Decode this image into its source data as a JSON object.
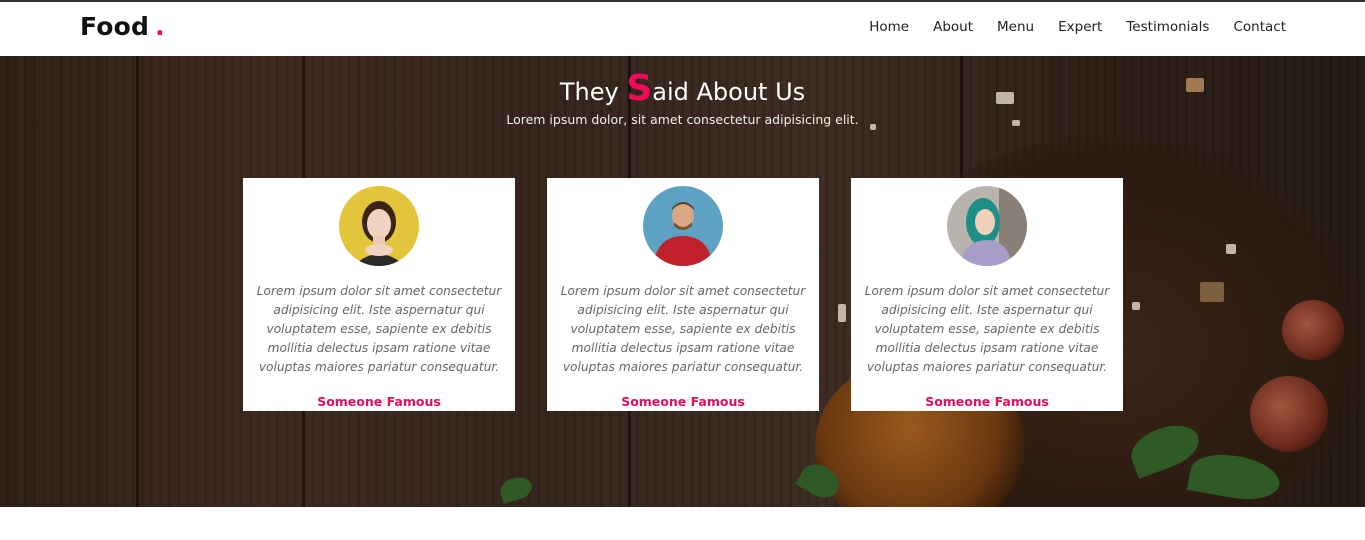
{
  "brand": {
    "name": "Food",
    "dot": ".",
    "accent": "#f7095a"
  },
  "nav": {
    "items": [
      {
        "label": "Home"
      },
      {
        "label": "About"
      },
      {
        "label": "Menu"
      },
      {
        "label": "Expert"
      },
      {
        "label": "Testimonials"
      },
      {
        "label": "Contact"
      }
    ]
  },
  "section": {
    "title_pre": "They ",
    "title_highlight": "S",
    "title_post": "aid About Us",
    "subtitle": "Lorem ipsum dolor, sit amet consectetur adipisicing elit."
  },
  "testimonials": [
    {
      "avatar_icon": "woman-portrait-icon",
      "quote": "Lorem ipsum dolor sit amet consectetur adipisicing elit. Iste aspernatur qui voluptatem esse, sapiente ex debitis mollitia delectus ipsam ratione vitae voluptas maiores pariatur consequatur.",
      "name": "Someone Famous"
    },
    {
      "avatar_icon": "man-portrait-icon",
      "quote": "Lorem ipsum dolor sit amet consectetur adipisicing elit. Iste aspernatur qui voluptatem esse, sapiente ex debitis mollitia delectus ipsam ratione vitae voluptas maiores pariatur consequatur.",
      "name": "Someone Famous"
    },
    {
      "avatar_icon": "woman-teal-hair-portrait-icon",
      "quote": "Lorem ipsum dolor sit amet consectetur adipisicing elit. Iste aspernatur qui voluptatem esse, sapiente ex debitis mollitia delectus ipsam ratione vitae voluptas maiores pariatur consequatur.",
      "name": "Someone Famous"
    }
  ],
  "colors": {
    "name_accent": "#e40c5d",
    "hero_wood": "#33231a"
  }
}
